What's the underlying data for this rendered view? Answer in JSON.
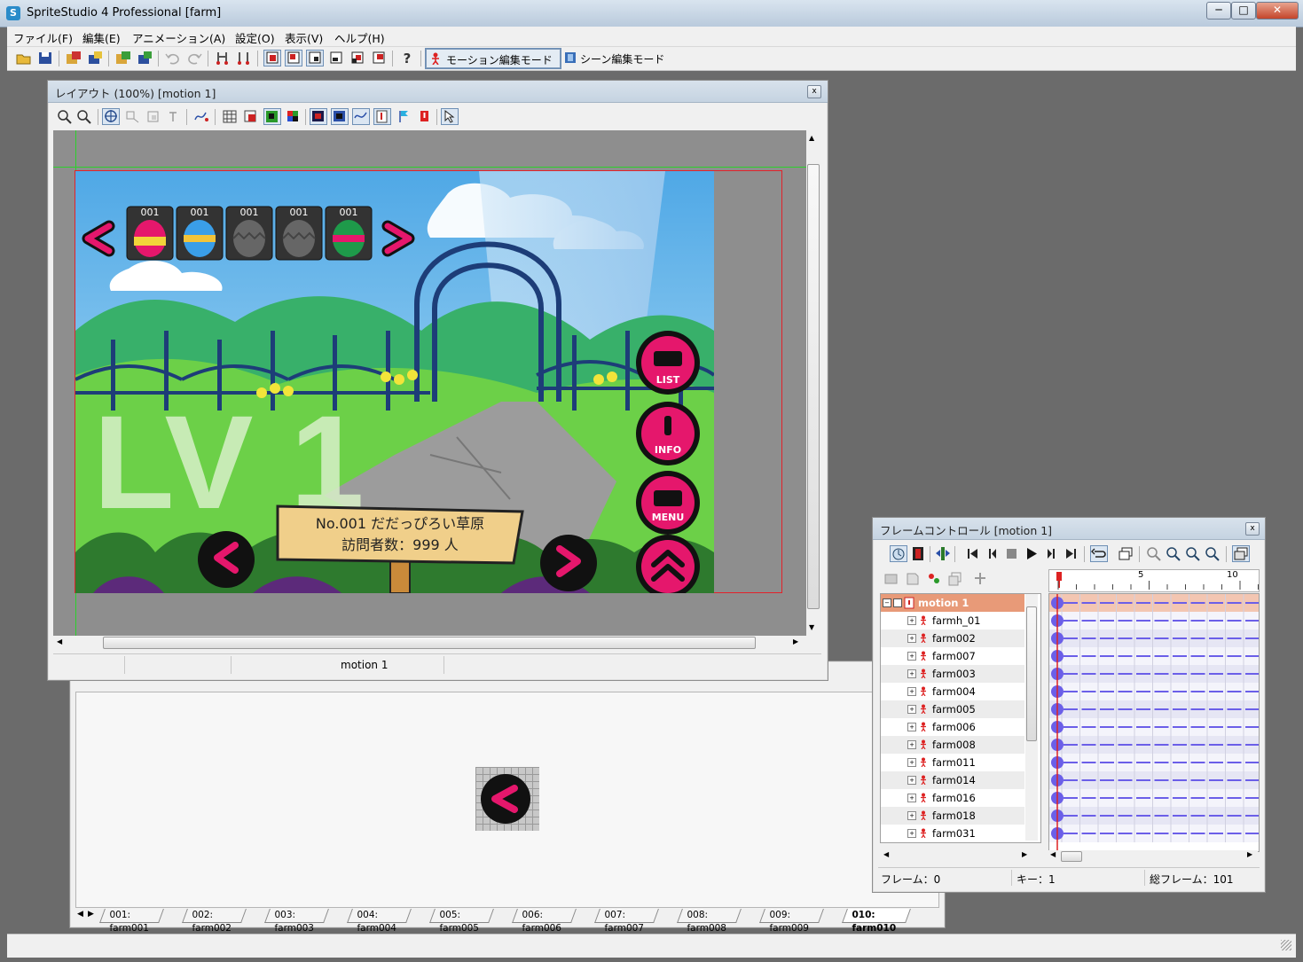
{
  "window": {
    "title": "SpriteStudio 4 Professional [farm]",
    "app_icon": "S",
    "min_label": "─",
    "max_label": "□",
    "close_label": "✕"
  },
  "menu": [
    "ファイル(F)",
    "編集(E)",
    "アニメーション(A)",
    "設定(O)",
    "表示(V)",
    "ヘルプ(H)"
  ],
  "toolbar": {
    "motion_mode_label": "モーション編集モード",
    "scene_mode_label": "シーン編集モード",
    "help_label": "?"
  },
  "layout_window": {
    "title": "レイアウト (100%) [motion 1]",
    "close_label": "x",
    "status_motion": "motion 1"
  },
  "game": {
    "egg_labels": [
      "001",
      "001",
      "001",
      "001",
      "001"
    ],
    "lv_text": "LV 1",
    "sign_line1": "No.001 だだっぴろい草原",
    "sign_line2": "訪問者数：999 人",
    "btn_list": "LIST",
    "btn_info": "INFO",
    "btn_menu": "MENU"
  },
  "cell_window": {
    "tabs": [
      "001: farm001",
      "002: farm002",
      "003: farm003",
      "004: farm004",
      "005: farm005",
      "006: farm006",
      "007: farm007",
      "008: farm008",
      "009: farm009",
      "010: farm010"
    ],
    "active_tab": "010: farm010"
  },
  "frame_window": {
    "title": "フレームコントロール [motion 1]",
    "close_label": "x",
    "ruler_5": "5",
    "ruler_10": "10",
    "root_label": "motion 1",
    "parts": [
      "farmh_01",
      "farm002",
      "farm007",
      "farm003",
      "farm004",
      "farm005",
      "farm006",
      "farm008",
      "farm011",
      "farm014",
      "farm016",
      "farm018",
      "farm031"
    ],
    "status_frame": "フレーム：0",
    "status_key": "キー：1",
    "status_total": "総フレーム：101"
  },
  "colors": {
    "accent_pink": "#e5176c",
    "selection_orange": "#e89a78",
    "key_blue": "#6b5fe8",
    "grass": "#78d23d",
    "sky": "#7fc6ee"
  }
}
